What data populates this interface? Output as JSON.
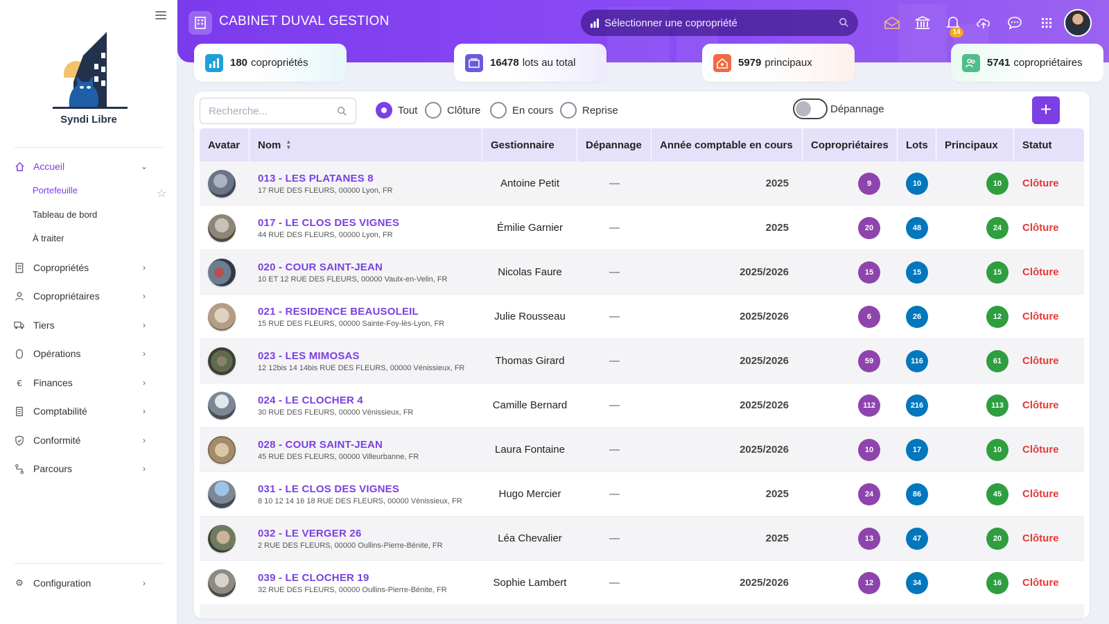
{
  "sidebar": {
    "brand": "Syndi Libre",
    "nav": [
      {
        "label": "Accueil",
        "icon": "home-icon"
      },
      {
        "label": "Copropriétés",
        "icon": "building-icon"
      },
      {
        "label": "Copropriétaires",
        "icon": "user-icon"
      },
      {
        "label": "Tiers",
        "icon": "truck-icon"
      },
      {
        "label": "Opérations",
        "icon": "wallet-icon"
      },
      {
        "label": "Finances",
        "icon": "euro-icon"
      },
      {
        "label": "Comptabilité",
        "icon": "ledger-icon"
      },
      {
        "label": "Conformité",
        "icon": "shield-icon"
      },
      {
        "label": "Parcours",
        "icon": "route-icon"
      }
    ],
    "sub": [
      "Portefeuille",
      "Tableau de bord",
      "À traiter"
    ],
    "config": "Configuration"
  },
  "header": {
    "title": "CABINET DUVAL GESTION",
    "select_placeholder": "Sélectionner une copropriété",
    "notif_count": "14"
  },
  "stats": [
    {
      "value": "180",
      "label": "copropriétés"
    },
    {
      "value": "16478",
      "label": "lots au total"
    },
    {
      "value": "5979",
      "label": "principaux"
    },
    {
      "value": "5741",
      "label": "copropriétaires"
    }
  ],
  "filters": {
    "search_placeholder": "Recherche...",
    "radios": [
      "Tout",
      "Clôture",
      "En cours",
      "Reprise"
    ],
    "toggle_label": "Dépannage",
    "add_label": "+"
  },
  "table": {
    "headers": [
      "Avatar",
      "Nom",
      "Gestionnaire",
      "Dépannage",
      "Année comptable en cours",
      "Copropriétaires",
      "Lots",
      "Principaux",
      "Statut"
    ],
    "rows": [
      {
        "name": "013 - LES PLATANES 8",
        "address": "17 RUE DES FLEURS, 00000 Lyon, FR",
        "manager": "Antoine Petit",
        "dep": "—",
        "year": "2025",
        "copro": "9",
        "lots": "10",
        "princ": "10",
        "status": "Clôture"
      },
      {
        "name": "017 - LE CLOS DES VIGNES",
        "address": "44 RUE DES FLEURS, 00000 Lyon, FR",
        "manager": "Émilie Garnier",
        "dep": "—",
        "year": "2025",
        "copro": "20",
        "lots": "48",
        "princ": "24",
        "status": "Clôture"
      },
      {
        "name": "020 - COUR SAINT-JEAN",
        "address": "10 ET 12 RUE DES FLEURS, 00000 Vaulx-en-Velin, FR",
        "manager": "Nicolas Faure",
        "dep": "—",
        "year": "2025/2026",
        "copro": "15",
        "lots": "15",
        "princ": "15",
        "status": "Clôture"
      },
      {
        "name": "021 - RESIDENCE BEAUSOLEIL",
        "address": "15 RUE DES FLEURS, 00000 Sainte-Foy-lès-Lyon, FR",
        "manager": "Julie Rousseau",
        "dep": "—",
        "year": "2025/2026",
        "copro": "6",
        "lots": "26",
        "princ": "12",
        "status": "Clôture"
      },
      {
        "name": "023 - LES MIMOSAS",
        "address": "12 12bis 14 14bis RUE DES FLEURS, 00000 Vénissieux, FR",
        "manager": "Thomas Girard",
        "dep": "—",
        "year": "2025/2026",
        "copro": "59",
        "lots": "116",
        "princ": "61",
        "status": "Clôture"
      },
      {
        "name": "024 - LE CLOCHER 4",
        "address": "30 RUE DES FLEURS, 00000 Vénissieux, FR",
        "manager": "Camille Bernard",
        "dep": "—",
        "year": "2025/2026",
        "copro": "112",
        "lots": "216",
        "princ": "113",
        "status": "Clôture"
      },
      {
        "name": "028 - COUR SAINT-JEAN",
        "address": "45 RUE DES FLEURS, 00000 Villeurbanne, FR",
        "manager": "Laura Fontaine",
        "dep": "—",
        "year": "2025/2026",
        "copro": "10",
        "lots": "17",
        "princ": "10",
        "status": "Clôture"
      },
      {
        "name": "031 - LE CLOS DES VIGNES",
        "address": "8 10 12 14 16 18 RUE DES FLEURS, 00000 Vénissieux, FR",
        "manager": "Hugo Mercier",
        "dep": "—",
        "year": "2025",
        "copro": "24",
        "lots": "86",
        "princ": "45",
        "status": "Clôture"
      },
      {
        "name": "032 - LE VERGER 26",
        "address": "2 RUE DES FLEURS, 00000 Oullins-Pierre-Bénite, FR",
        "manager": "Léa Chevalier",
        "dep": "—",
        "year": "2025",
        "copro": "13",
        "lots": "47",
        "princ": "20",
        "status": "Clôture"
      },
      {
        "name": "039 - LE CLOCHER 19",
        "address": "32 RUE DES FLEURS, 00000 Oullins-Pierre-Bénite, FR",
        "manager": "Sophie Lambert",
        "dep": "—",
        "year": "2025/2026",
        "copro": "12",
        "lots": "34",
        "princ": "16",
        "status": "Clôture"
      }
    ]
  },
  "colors": {
    "accent": "#7b3fe4",
    "copro_pill": "#8e44ad",
    "lots_pill": "#0277bd",
    "princ_pill": "#2e9e3f",
    "status": "#e53935"
  }
}
